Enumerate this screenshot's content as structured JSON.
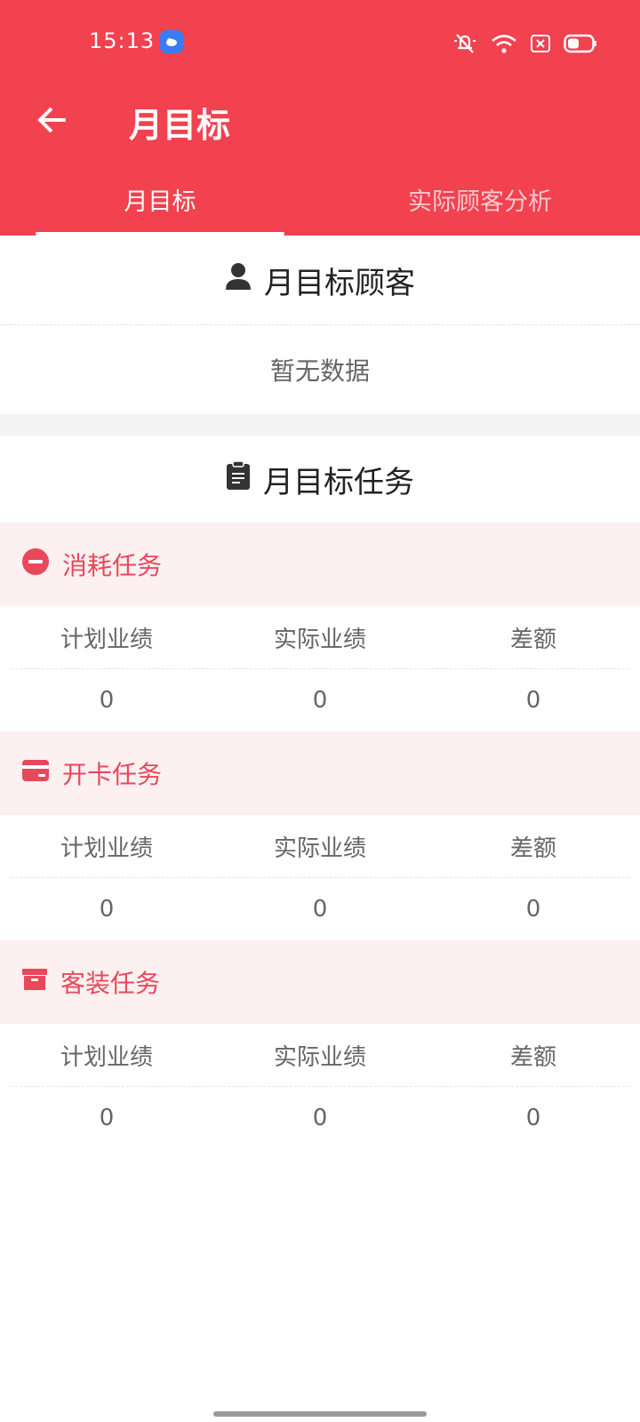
{
  "status": {
    "time": "15:13"
  },
  "header": {
    "title": "月目标"
  },
  "tabs": [
    {
      "label": "月目标"
    },
    {
      "label": "实际顾客分析"
    }
  ],
  "customers": {
    "title": "月目标顾客",
    "empty_text": "暂无数据"
  },
  "tasks_section": {
    "title": "月目标任务"
  },
  "tasks": [
    {
      "name": "消耗任务",
      "icon": "minus-circle-icon",
      "columns": [
        "计划业绩",
        "实际业绩",
        "差额"
      ],
      "values": [
        "0",
        "0",
        "0"
      ]
    },
    {
      "name": "开卡任务",
      "icon": "card-icon",
      "columns": [
        "计划业绩",
        "实际业绩",
        "差额"
      ],
      "values": [
        "0",
        "0",
        "0"
      ]
    },
    {
      "name": "客装任务",
      "icon": "box-icon",
      "columns": [
        "计划业绩",
        "实际业绩",
        "差额"
      ],
      "values": [
        "0",
        "0",
        "0"
      ]
    }
  ],
  "colors": {
    "primary": "#f2414f",
    "task_header_bg": "#fdf0f1",
    "task_text": "#e8485a"
  }
}
